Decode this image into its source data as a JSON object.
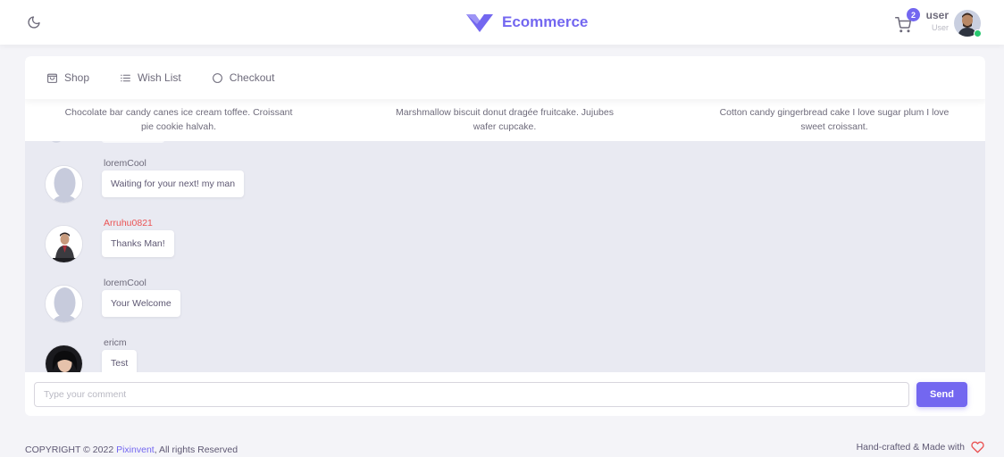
{
  "navbar": {
    "brand_name": "Ecommerce",
    "brand_color": "#7367f0",
    "theme_icon": "moon-icon",
    "cart_icon": "shopping-cart-icon",
    "cart_count": "2",
    "user_name": "user",
    "user_role": "User",
    "online_color": "#28c76f"
  },
  "tabs": [
    {
      "label": "Shop",
      "icon": "shopping-bag-icon"
    },
    {
      "label": "Wish List",
      "icon": "list-icon"
    },
    {
      "label": "Checkout",
      "icon": "circle-icon"
    }
  ],
  "features": [
    "Chocolate bar candy canes ice cream toffee. Croissant pie cookie halvah.",
    "Marshmallow biscuit donut dragée fruitcake. Jujubes wafer cupcake.",
    "Cotton candy gingerbread cake I love sugar plum I love sweet croissant."
  ],
  "messages": [
    {
      "user": "loremCool",
      "text": "Waiting for your next! my man",
      "avatar": "default-avatar-icon",
      "highlight": false
    },
    {
      "user": "Arruhu0821",
      "text": "Thanks Man!",
      "avatar": "user-photo",
      "highlight": true
    },
    {
      "user": "loremCool",
      "text": "Your Welcome",
      "avatar": "default-avatar-icon",
      "highlight": false
    },
    {
      "user": "ericm",
      "text": "Test",
      "avatar": "user-photo",
      "highlight": false
    }
  ],
  "comment": {
    "placeholder": "Type your comment",
    "value": "",
    "send_label": "Send"
  },
  "footer": {
    "copyright_prefix": "COPYRIGHT © 2022",
    "company": "Pixinvent",
    "copyright_suffix": ", All rights Reserved",
    "made_with": "Hand-crafted & Made with",
    "heart_icon": "heart-icon",
    "heart_color": "#ea5455"
  }
}
